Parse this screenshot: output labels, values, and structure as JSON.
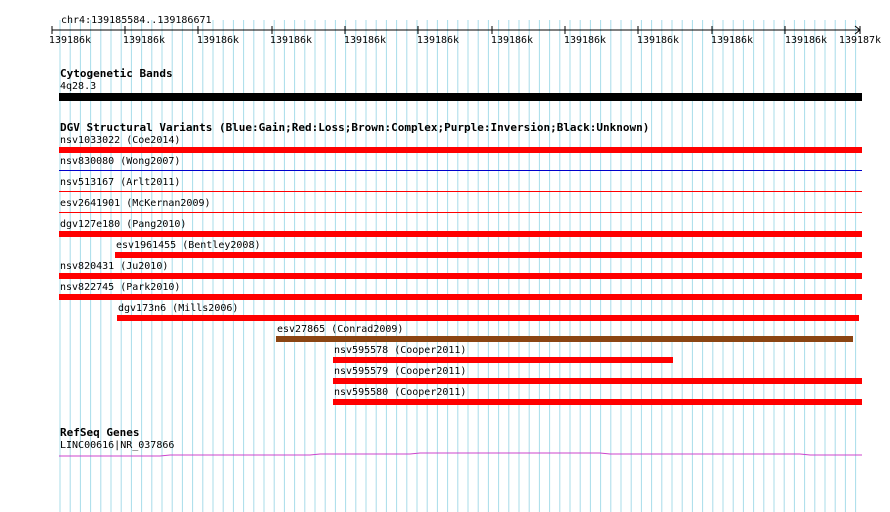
{
  "ruler": {
    "location": "chr4:139185584..139186671",
    "ticks": [
      "139186k",
      "139186k",
      "139186k",
      "139186k",
      "139186k",
      "139186k",
      "139186k",
      "139186k",
      "139186k",
      "139186k",
      "139186k",
      "139187k"
    ]
  },
  "tracks": {
    "cytoband": {
      "title": "Cytogenetic Bands",
      "band_label": "4q28.3",
      "color": "#000000"
    },
    "dgv": {
      "title": "DGV Structural Variants (Blue:Gain;Red:Loss;Brown:Complex;Purple:Inversion;Black:Unknown)",
      "colors": {
        "loss": "#ff0000",
        "gain": "#0000cc",
        "complex": "#8b4513"
      },
      "variants": [
        {
          "label": "nsv1033022 (Coe2014)",
          "type": "loss",
          "style": "thick"
        },
        {
          "label": "nsv830080 (Wong2007)",
          "type": "gain",
          "style": "thin"
        },
        {
          "label": "nsv513167 (Arlt2011)",
          "type": "loss",
          "style": "thin"
        },
        {
          "label": "esv2641901 (McKernan2009)",
          "type": "loss",
          "style": "thin"
        },
        {
          "label": "dgv127e180 (Pang2010)",
          "type": "loss",
          "style": "thick"
        },
        {
          "label": "esv1961455 (Bentley2008)",
          "type": "loss",
          "style": "thick"
        },
        {
          "label": "nsv820431 (Ju2010)",
          "type": "loss",
          "style": "thick"
        },
        {
          "label": "nsv822745 (Park2010)",
          "type": "loss",
          "style": "thick"
        },
        {
          "label": "dgv173n6 (Mills2006)",
          "type": "loss",
          "style": "thick"
        },
        {
          "label": "esv27865 (Conrad2009)",
          "type": "complex",
          "style": "thick"
        },
        {
          "label": "nsv595578 (Cooper2011)",
          "type": "loss",
          "style": "thick"
        },
        {
          "label": "nsv595579 (Cooper2011)",
          "type": "loss",
          "style": "thick"
        },
        {
          "label": "nsv595580 (Cooper2011)",
          "type": "loss",
          "style": "thick"
        }
      ]
    },
    "refseq": {
      "title": "RefSeq Genes",
      "gene_label": "LINC00616|NR_037866",
      "color": "#cc44cc"
    }
  },
  "colors": {
    "grid": "#a8dcea",
    "ruler": "#000000"
  }
}
